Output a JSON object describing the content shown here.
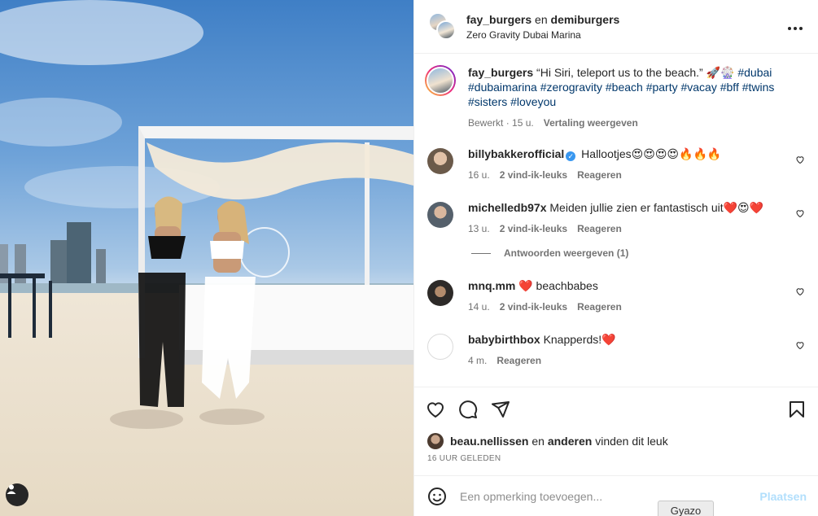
{
  "header": {
    "author": "fay_burgers",
    "connector": "en",
    "coauthor": "demiburgers",
    "location": "Zero Gravity Dubai Marina",
    "more_icon": "more-horizontal-icon"
  },
  "caption": {
    "author": "fay_burgers",
    "text": "“Hi Siri, teleport us to the beach.” 🚀🎡",
    "hashtags": "#dubai #dubaimarina #zerogravity #beach #party #vacay #bff #twins #sisters #loveyou",
    "edited": "Bewerkt",
    "time": "15 u.",
    "translation": "Vertaling weergeven"
  },
  "comments": [
    {
      "user": "billybakkerofficial",
      "verified": true,
      "text": "Hallootjes😍😍😍😍🔥🔥🔥",
      "time": "16 u.",
      "likes": "2 vind-ik-leuks",
      "reply": "Reageren"
    },
    {
      "user": "michelledb97x",
      "verified": false,
      "text": "Meiden jullie zien er fantastisch uit❤️😍❤️",
      "time": "13 u.",
      "likes": "2 vind-ik-leuks",
      "reply": "Reageren"
    },
    {
      "user": "mnq.mm",
      "verified": false,
      "text": "❤️ beachbabes",
      "time": "14 u.",
      "likes": "2 vind-ik-leuks",
      "reply": "Reageren"
    },
    {
      "user": "babybirthbox",
      "verified": false,
      "text": "Knapperds!❤️",
      "time": "4 m.",
      "likes": "",
      "reply": "Reageren"
    }
  ],
  "replies_toggle": "Antwoorden weergeven (1)",
  "actions": {
    "like_icon": "heart-icon",
    "comment_icon": "comment-icon",
    "share_icon": "send-icon",
    "save_icon": "bookmark-icon"
  },
  "likes": {
    "user": "beau.nellissen",
    "and": "en",
    "others": "anderen",
    "suffix": "vinden dit leuk"
  },
  "timestamp": "16 UUR GELEDEN",
  "add_comment": {
    "placeholder": "Een opmerking toevoegen...",
    "post_label": "Plaatsen",
    "emoji_icon": "emoji-icon"
  },
  "overlay": {
    "gyazo_label": "Gyazo"
  },
  "colors": {
    "link": "#00376b",
    "muted": "#737373",
    "post_disabled": "#b2dffc",
    "verified": "#3897f0"
  }
}
